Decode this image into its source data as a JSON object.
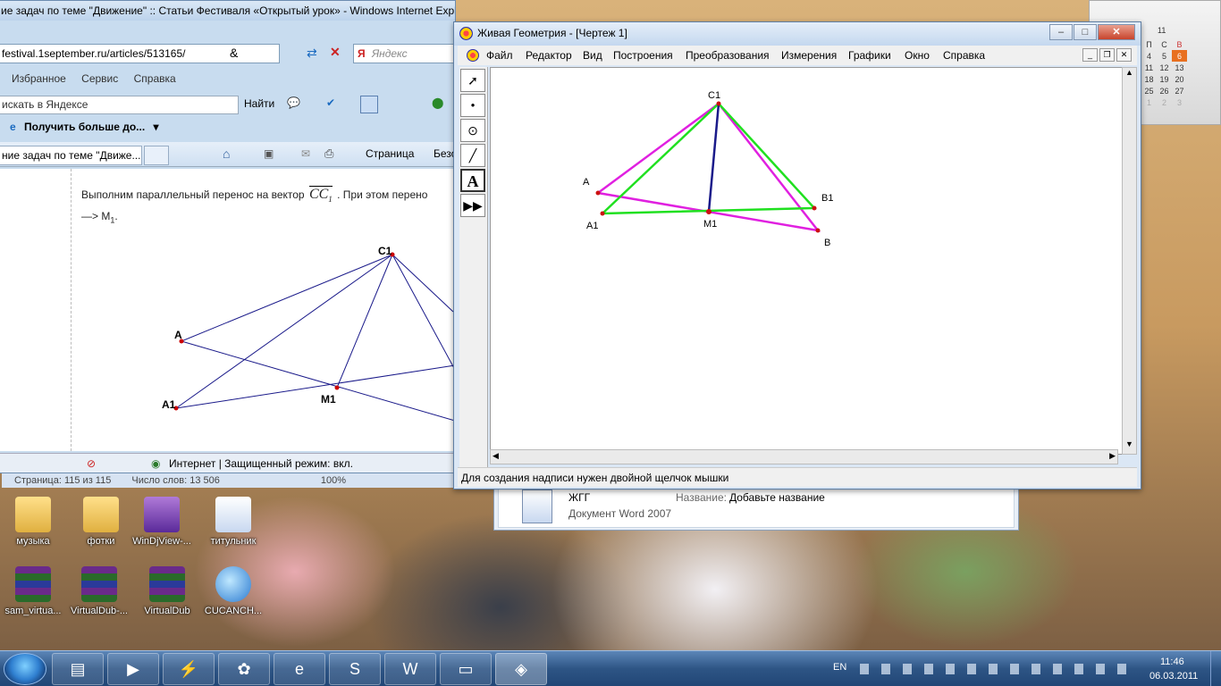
{
  "ie": {
    "title": "ие задач по теме \"Движение\" :: Статьи Фестиваля «Открытый урок» - Windows Internet Explo",
    "address": "festival.1september.ru/articles/513165/",
    "yandex_label": "Яндекс",
    "menu": [
      "Избранное",
      "Сервис",
      "Справка"
    ],
    "search_placeholder": "искать в Яндексе",
    "find_button": "Найти",
    "fav_link": "Получить больше до...",
    "tab_label": "ние задач по теме \"Движе...",
    "page_menu": "Страница",
    "safety_menu": "Безо",
    "article_text_1": "Выполним параллельный перенос на вектор",
    "vector_label": "CC",
    "vector_sub": "1",
    "article_text_2": ". При этом перено",
    "article_text_3": "—> M",
    "article_text_3_sub": "1",
    "article_text_3_end": ".",
    "figure_labels": {
      "C1": "C1",
      "A": "A",
      "A1": "A1",
      "M1": "M1"
    },
    "status": "Интернет | Защищенный режим: вкл."
  },
  "word_status": {
    "page": "Страница: 115 из 115",
    "words": "Число слов: 13 506",
    "zoom": "100%"
  },
  "explorer": {
    "filename": "ЖГГ",
    "title_label": "Название:",
    "title_value": "Добавьте название",
    "doc_type": "Документ Word 2007"
  },
  "geo": {
    "title": "Живая Геометрия - [Чертеж 1]",
    "menu": [
      "Файл",
      "Редактор",
      "Вид",
      "Построения",
      "Преобразования",
      "Измерения",
      "Графики",
      "Окно",
      "Справка"
    ],
    "tools": [
      "arrow-tool",
      "point-tool",
      "compass-tool",
      "straightedge-tool",
      "text-tool",
      "custom-tool"
    ],
    "text_tool_glyph": "A",
    "labels": {
      "C1": "C1",
      "A": "A",
      "A1": "A1",
      "M1": "M1",
      "B1": "B1",
      "B": "B"
    },
    "status": "Для создания надписи нужен двойной щелчок мышки",
    "colors": {
      "magenta": "#e020e0",
      "green": "#20e020",
      "navy": "#1a1a8a",
      "point": "#cc1111"
    }
  },
  "desktop_icons": [
    {
      "label": "музыка"
    },
    {
      "label": "фотки"
    },
    {
      "label": "WinDjView-..."
    },
    {
      "label": "титульник"
    },
    {
      "label": "sam_virtua..."
    },
    {
      "label": "VirtualDub-..."
    },
    {
      "label": "VirtualDub"
    },
    {
      "label": "CUCANCH..."
    }
  ],
  "calendar": {
    "head": [
      "П",
      "С",
      "В"
    ],
    "rows": [
      [
        "4",
        "5",
        "6"
      ],
      [
        "11",
        "12",
        "13"
      ],
      [
        "18",
        "19",
        "20"
      ],
      [
        "25",
        "26",
        "27"
      ],
      [
        "1",
        "2",
        "3"
      ]
    ],
    "top_num": "11"
  },
  "tray": {
    "lang": "EN",
    "time": "11:46",
    "date": "06.03.2011"
  }
}
